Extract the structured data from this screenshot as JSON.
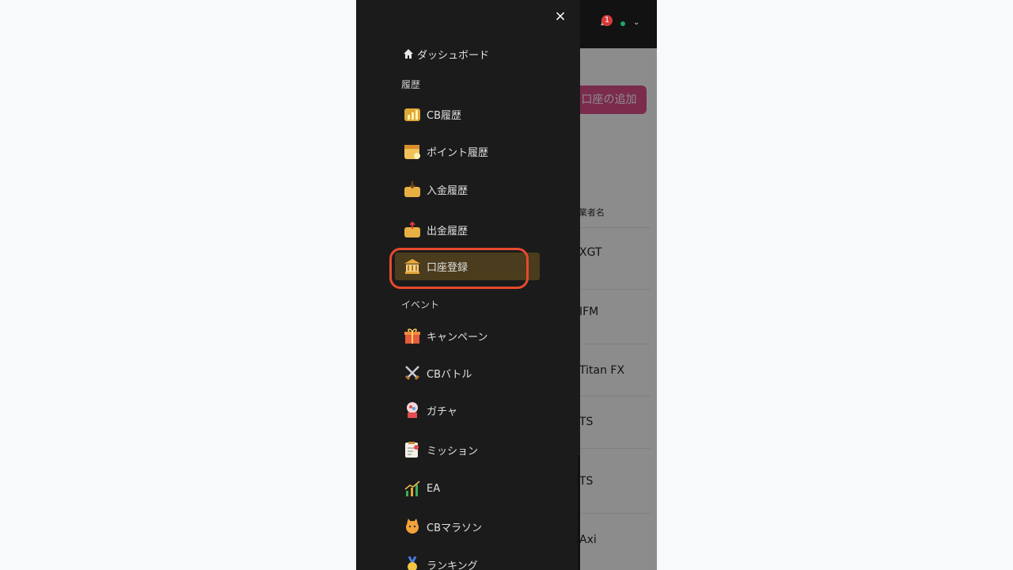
{
  "underlying_page": {
    "notification_count": "1",
    "add_account_button": "口座の追加",
    "column_header": "業者名",
    "rows": [
      "XGT",
      "IFM",
      "Titan FX",
      "TS",
      "TS",
      "Axi"
    ]
  },
  "drawer": {
    "close_label": "×",
    "dashboard": "ダッシュボード",
    "history_section": "履歴",
    "history_items": [
      "CB履歴",
      "ポイント履歴",
      "入金履歴",
      "出金履歴",
      "口座登録"
    ],
    "event_section": "イベント",
    "event_items": [
      "キャンペーン",
      "CBバトル",
      "ガチャ",
      "ミッション",
      "EA",
      "CBマラソン",
      "ランキング"
    ]
  },
  "colors": {
    "drawer_bg": "#1b1b1b",
    "active_item_bg": "#4a3c1c",
    "highlight_outline": "#e64a2e",
    "add_button": "#e14f8a"
  },
  "icons": {
    "dashboard": "home-icon",
    "cb_history": "bar-chart-icon",
    "points_history": "calendar-icon",
    "deposit_history": "inbox-in-icon",
    "withdraw_history": "inbox-out-icon",
    "account_registration": "bank-icon",
    "campaign": "gift-icon",
    "cb_battle": "crossed-swords-icon",
    "gacha": "gumball-machine-icon",
    "mission": "checklist-icon",
    "ea": "chart-up-icon",
    "cb_marathon": "cat-icon",
    "ranking": "medal-icon"
  }
}
